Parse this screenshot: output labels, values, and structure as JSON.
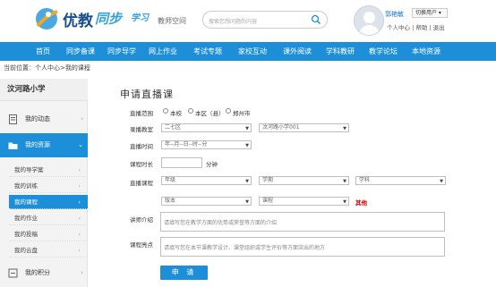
{
  "header": {
    "brand_main": "优教",
    "brand_sync": "同步",
    "brand_study": "学习",
    "subtitle": "教师空间",
    "search_placeholder": "搜索您想问题的内容",
    "username": "郭艳敏",
    "switch_user": "切换用户",
    "user_links": "个人中心 | 帮助 | 退出"
  },
  "nav": {
    "items": [
      "首页",
      "同步备课",
      "同步导学",
      "网上作业",
      "考试专题",
      "家校互动",
      "课外阅读",
      "学科教研",
      "教学论坛",
      "本地资源"
    ]
  },
  "breadcrumb": "当前位置：个人中心>我的课程",
  "sidebar": {
    "school": "汶河路小学",
    "main_items": [
      "我的动态",
      "我的资源",
      "我的积分"
    ],
    "sub_items": [
      "我的导学案",
      "我的训练",
      "我的课程",
      "我的作业",
      "我的投稿",
      "我的云盘"
    ]
  },
  "form": {
    "title": "申请直播课",
    "range_label": "直播范围",
    "range_options": [
      "本校",
      "本区（县）",
      "郑州市"
    ],
    "room_label": "录播教室",
    "room_district": "二七区",
    "room_school": "汶河路小学001",
    "time_label": "直播时间",
    "time_placeholder": "年--月--日--时--分",
    "duration_label": "课程时长",
    "duration_unit": "分钟",
    "course_label": "直播课程",
    "grade_ph": "年级",
    "term_ph": "学期",
    "subject_ph": "学科",
    "edition_ph": "版本",
    "lesson_ph": "课程",
    "other_label": "其他",
    "teacher_label": "讲师介绍",
    "teacher_ph": "请填写您在教学方面的优势或荣誉等方面的介绍",
    "highlight_label": "课程亮点",
    "highlight_ph": "请填写您在本节课教学设计、课堂组织或学生评价等方面突出的地方",
    "submit": "申 请"
  }
}
